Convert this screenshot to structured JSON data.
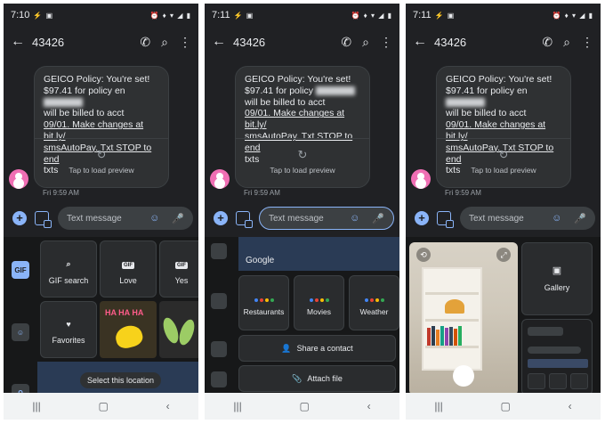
{
  "colors": {
    "background": "#202124",
    "accent": "#8ab4f8",
    "avatar": "#f06fb4",
    "bubble": "#2f3133"
  },
  "screens": [
    {
      "status_time": "7:10",
      "contact": "43426",
      "message_lines": [
        "GEICO Policy: You're set!",
        "$97.41 for policy en",
        "will be billed to acct",
        "09/01. Make changes at bit.ly/",
        "smsAutoPay. Txt STOP to end",
        "txts"
      ],
      "preview_label": "Tap to load preview",
      "timestamp": "Fri 9:59 AM",
      "compose_placeholder": "Text message",
      "tray": {
        "gif_badge": "GIF",
        "tiles": [
          {
            "label": "GIF search",
            "icon": "search-icon"
          },
          {
            "label": "Love",
            "icon": "gif-badge"
          },
          {
            "label": "Yes",
            "icon": "gif-badge"
          },
          {
            "label": "Favorites",
            "icon": "heart-icon"
          }
        ],
        "sticker_text": "HA HA HA",
        "location_chip": "Select this location"
      }
    },
    {
      "status_time": "7:11",
      "contact": "43426",
      "message_lines": [
        "GEICO Policy: You're set!",
        "$97.41 for policy",
        "will be billed to acct",
        "09/01. Make changes at bit.ly/",
        "smsAutoPay. Txt STOP to end",
        "txts"
      ],
      "preview_label": "Tap to load preview",
      "timestamp": "Fri 9:59 AM",
      "compose_placeholder": "Text message",
      "tray": {
        "google_label": "Google",
        "assistant_tiles": [
          "Restaurants",
          "Movies",
          "Weather"
        ],
        "share_contact": "Share a contact",
        "attach_file": "Attach file"
      }
    },
    {
      "status_time": "7:11",
      "contact": "43426",
      "message_lines": [
        "GEICO Policy: You're set!",
        "$97.41 for policy en",
        "will be billed to acct",
        "09/01. Make changes at bit.ly/",
        "smsAutoPay. Txt STOP to end",
        "txts"
      ],
      "preview_label": "Tap to load preview",
      "timestamp": "Fri 9:59 AM",
      "compose_placeholder": "Text message",
      "tray": {
        "gallery_label": "Gallery"
      }
    }
  ]
}
